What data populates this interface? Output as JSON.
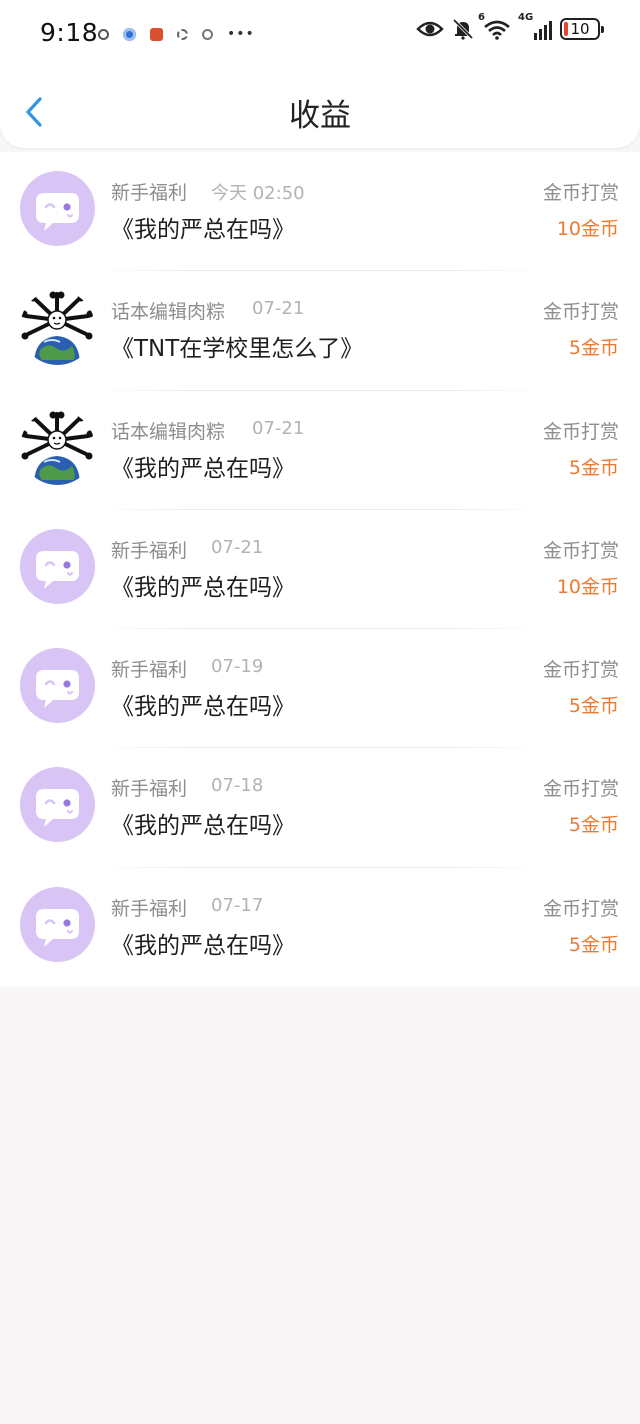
{
  "status_bar": {
    "time": "9:18",
    "more": "•••",
    "network": "4G",
    "wifi_badge": "6",
    "battery": "10"
  },
  "header": {
    "title": "收益"
  },
  "colors": {
    "accent_blue": "#2f95e8",
    "amount_orange": "#ef7a2e",
    "avatar_purple": "#d8c5f6"
  },
  "rows": [
    {
      "sender": "新手福利",
      "date": "今天 02:50",
      "book": "《我的严总在吗》",
      "type": "金币打赏",
      "amount": "10金币",
      "avatar": "chat-bubble"
    },
    {
      "sender": "话本编辑肉粽",
      "date": "07-21",
      "book": "《TNT在学校里怎么了》",
      "type": "金币打赏",
      "amount": "5金币",
      "avatar": "editor-meme"
    },
    {
      "sender": "话本编辑肉粽",
      "date": "07-21",
      "book": "《我的严总在吗》",
      "type": "金币打赏",
      "amount": "5金币",
      "avatar": "editor-meme"
    },
    {
      "sender": "新手福利",
      "date": "07-21",
      "book": "《我的严总在吗》",
      "type": "金币打赏",
      "amount": "10金币",
      "avatar": "chat-bubble"
    },
    {
      "sender": "新手福利",
      "date": "07-19",
      "book": "《我的严总在吗》",
      "type": "金币打赏",
      "amount": "5金币",
      "avatar": "chat-bubble"
    },
    {
      "sender": "新手福利",
      "date": "07-18",
      "book": "《我的严总在吗》",
      "type": "金币打赏",
      "amount": "5金币",
      "avatar": "chat-bubble"
    },
    {
      "sender": "新手福利",
      "date": "07-17",
      "book": "《我的严总在吗》",
      "type": "金币打赏",
      "amount": "5金币",
      "avatar": "chat-bubble"
    }
  ]
}
